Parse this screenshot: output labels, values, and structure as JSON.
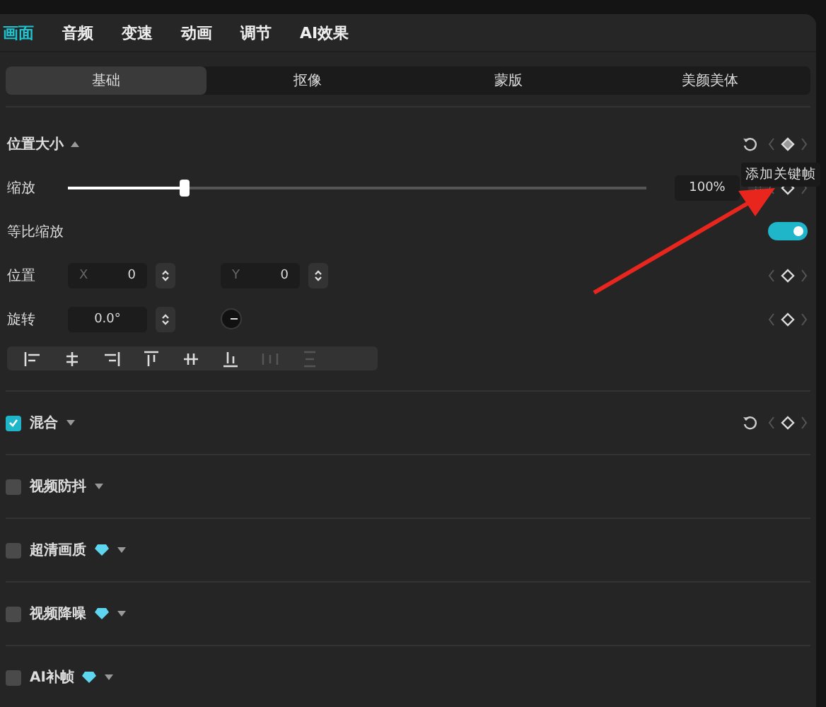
{
  "tabs": [
    {
      "label": "画面",
      "selected": true
    },
    {
      "label": "音频",
      "selected": false
    },
    {
      "label": "变速",
      "selected": false
    },
    {
      "label": "动画",
      "selected": false
    },
    {
      "label": "调节",
      "selected": false
    },
    {
      "label": "AI效果",
      "selected": false
    }
  ],
  "subtabs": [
    {
      "label": "基础",
      "selected": true
    },
    {
      "label": "抠像",
      "selected": false
    },
    {
      "label": "蒙版",
      "selected": false
    },
    {
      "label": "美颜美体",
      "selected": false
    }
  ],
  "transform": {
    "title": "位置大小",
    "expanded": true,
    "rows": [
      {
        "kind": "slider",
        "label": "缩放",
        "level": 0.2,
        "value": "100%"
      },
      {
        "kind": "toggle",
        "label": "等比缩放",
        "on": true
      },
      {
        "kind": "xy",
        "label": "位置",
        "x_label": "X",
        "x_value": "0",
        "y_label": "Y",
        "y_value": "0"
      },
      {
        "kind": "angle",
        "label": "旋转",
        "value": "0.0°"
      }
    ]
  },
  "tooltip": "添加关键帧",
  "sections": [
    {
      "label": "混合",
      "checked": true,
      "premium": false,
      "keyframe": true
    },
    {
      "label": "视频防抖",
      "checked": false,
      "premium": false,
      "keyframe": false
    },
    {
      "label": "超清画质",
      "checked": false,
      "premium": true,
      "keyframe": false
    },
    {
      "label": "视频降噪",
      "checked": false,
      "premium": true,
      "keyframe": false
    },
    {
      "label": "AI补帧",
      "checked": false,
      "premium": true,
      "keyframe": false
    }
  ]
}
